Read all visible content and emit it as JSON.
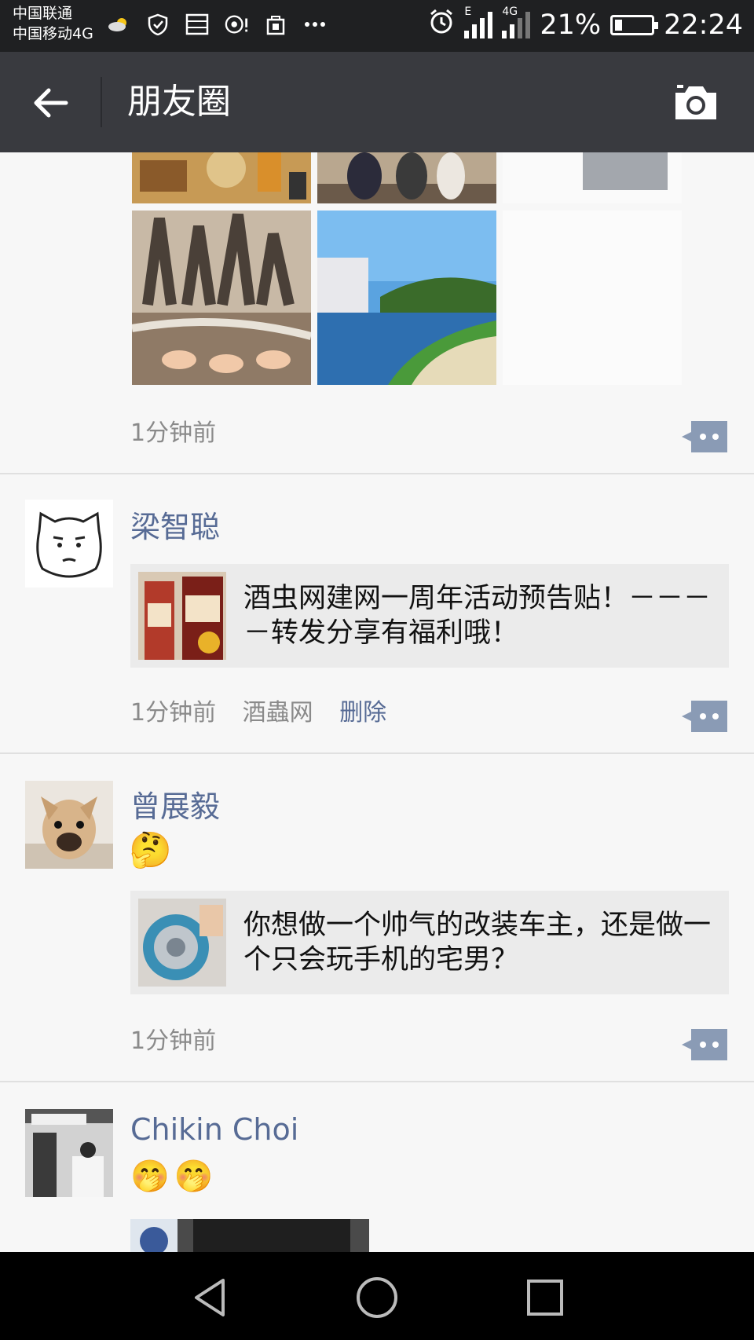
{
  "status_bar": {
    "carrier_1": "中国联通",
    "carrier_2": "中国移动4G",
    "network_1": "E",
    "network_2": "4G",
    "battery_percent": "21%",
    "battery_level": 0.21,
    "time": "22:24",
    "icons": [
      "weather-cloud-icon",
      "shield-icon",
      "sim-icon",
      "nfc-icon",
      "shop-icon",
      "more-dots-icon",
      "alarm-icon",
      "signal-icon",
      "battery-icon"
    ]
  },
  "header": {
    "title": "朋友圈"
  },
  "posts": [
    {
      "timestamp": "1分钟前"
    },
    {
      "username": "梁智聪",
      "share_text": "酒虫网建网一周年活动预告贴！－－－－转发分享有福利哦！",
      "timestamp": "1分钟前",
      "source": "酒蟲网",
      "delete_label": "删除"
    },
    {
      "username": "曾展毅",
      "emoji": "🤔",
      "share_text": "你想做一个帅气的改装车主，还是做一个只会玩手机的宅男？",
      "timestamp": "1分钟前"
    },
    {
      "username": "Chikin Choi",
      "emoji": "🤭🤭"
    }
  ],
  "colors": {
    "status_bar_bg": "#1f2022",
    "title_bar_bg": "#393a3f",
    "username": "#576b95",
    "feed_bg": "#f7f7f7",
    "link_card_bg": "#ebebeb"
  }
}
